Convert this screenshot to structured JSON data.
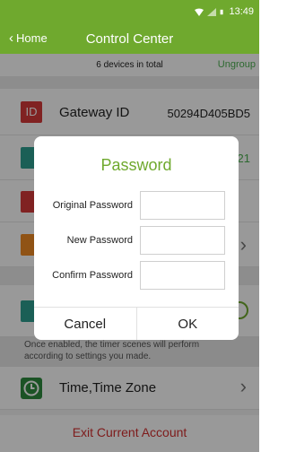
{
  "status_bar": {
    "time": "13:49",
    "icons": [
      "wifi-icon",
      "signal-icon",
      "battery-icon"
    ]
  },
  "header": {
    "back_label": "Home",
    "title": "Control Center"
  },
  "summary": {
    "device_count": "6 devices in total",
    "ungroup_label": "Ungroup"
  },
  "gateway": {
    "label": "Gateway ID",
    "value": "50294D405BD5",
    "icon": "ID"
  },
  "partial_rows": [
    {
      "icon": "sync-icon",
      "color": "#2e9e8f",
      "value_fragment": "21"
    },
    {
      "icon": "tool-icon",
      "color": "#d63a3a"
    },
    {
      "icon": "transfer-icon",
      "color": "#f08a24"
    },
    {
      "icon": "timer-scene-icon",
      "color": "#2e9e8f"
    }
  ],
  "dialog": {
    "title": "Password",
    "fields": [
      {
        "label": "Original Password",
        "value": ""
      },
      {
        "label": "New Password",
        "value": ""
      },
      {
        "label": "Confirm Password",
        "value": ""
      }
    ],
    "cancel_label": "Cancel",
    "ok_label": "OK"
  },
  "timer_note": "Once enabled, the timer scenes will perform according to settings you made.",
  "time_row": {
    "label": "Time,Time Zone",
    "icon": "clock-icon"
  },
  "exit_label": "Exit Current Account",
  "colors": {
    "brand_green": "#6fa92e",
    "accent_green": "#4caf50",
    "exit_red": "#d32f2f"
  }
}
